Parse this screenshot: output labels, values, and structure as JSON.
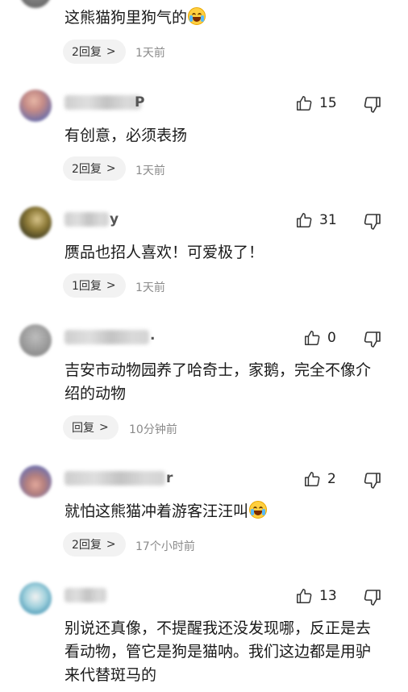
{
  "comments": [
    {
      "text": "这熊猫狗里狗气的",
      "emoji": "crying-laughing-emoji",
      "replies_label": "2回复",
      "time": "1天前"
    },
    {
      "name_tail": "P",
      "likes": "15",
      "text": "有创意，必须表扬",
      "replies_label": "2回复",
      "time": "1天前"
    },
    {
      "name_tail": "y",
      "likes": "31",
      "text": "赝品也招人喜欢！可爱极了！",
      "replies_label": "1回复",
      "time": "1天前"
    },
    {
      "name_tail": ".",
      "likes": "0",
      "text": "吉安市动物园养了哈奇士，家鹅，完全不像介绍的动物",
      "replies_label": "回复",
      "time": "10分钟前"
    },
    {
      "name_tail": "r",
      "likes": "2",
      "text": "就怕这熊猫冲着游客汪汪叫",
      "emoji": "crying-laughing-emoji",
      "replies_label": "2回复",
      "time": "17个小时前"
    },
    {
      "likes": "13",
      "text": "别说还真像，不提醒我还没发现哪，反正是去看动物，管它是狗是猫呐。我们这边都是用驴来代替斑马的"
    }
  ]
}
